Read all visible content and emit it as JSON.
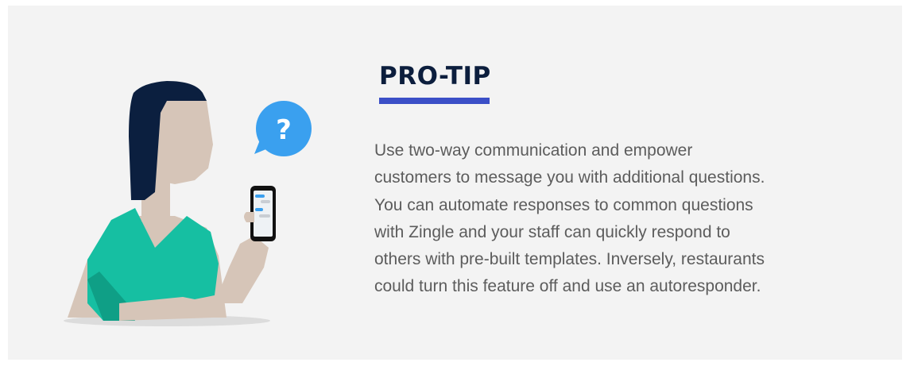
{
  "tip": {
    "heading": "PRO-TIP",
    "lines": [
      "Use two-way communication and empower",
      "customers to message you with additional questions.",
      "You can automate responses to common questions",
      "with Zingle and your staff can quickly respond to",
      "others with pre-built templates. Inversely, restaurants",
      "could turn this feature off and use an autoresponder."
    ]
  },
  "illustration": {
    "speech_bubble_glyph": "?",
    "icon": "woman-with-phone-illustration",
    "colors": {
      "hair": "#0b1f3f",
      "skin": "#d6c5b8",
      "shirt": "#16bfa2",
      "shirt_shadow": "#0f9f86",
      "bubble": "#3aa0ef",
      "phone": "#111111",
      "ground": "#dcdcdc"
    }
  },
  "colors": {
    "card_bg": "#f3f3f3",
    "heading": "#0c1e3d",
    "underline": "#3b4fc7",
    "body_text": "#5c5c5c"
  }
}
